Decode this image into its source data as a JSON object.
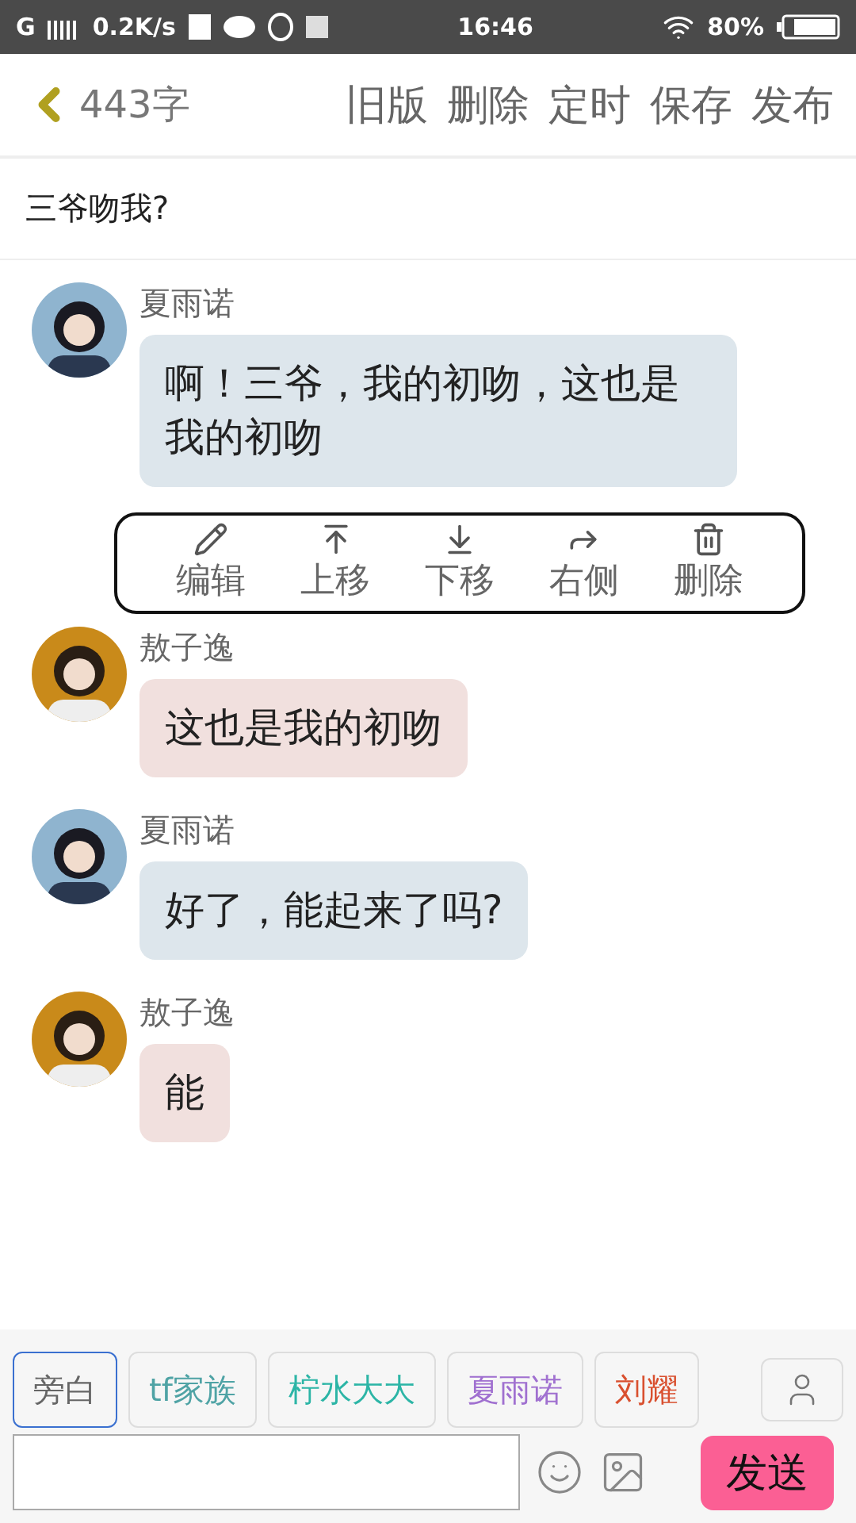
{
  "status_bar": {
    "network": "G",
    "speed": "0.2K/s",
    "time": "16:46",
    "battery": "80%"
  },
  "header": {
    "back": "443字",
    "actions": [
      "旧版",
      "删除",
      "定时",
      "保存",
      "发布"
    ]
  },
  "title": "三爷吻我?",
  "messages": [
    {
      "speaker": "夏雨诺",
      "text": "啊！三爷，我的初吻，这也是我的初吻",
      "color": "#dde6ec",
      "kind": "girl",
      "tools": [
        {
          "kind": "edit",
          "label": "编辑"
        },
        {
          "kind": "up",
          "label": "上移"
        },
        {
          "kind": "down",
          "label": "下移"
        },
        {
          "kind": "right",
          "label": "右侧"
        },
        {
          "kind": "delete",
          "label": "删除"
        }
      ]
    },
    {
      "speaker": "敖子逸",
      "text": "这也是我的初吻",
      "color": "#f1e0de",
      "kind": "boy"
    },
    {
      "speaker": "夏雨诺",
      "text": "好了，能起来了吗?",
      "color": "#dde6ec",
      "kind": "girl"
    },
    {
      "speaker": "敖子逸",
      "text": "能",
      "color": "#f1e0de",
      "kind": "boy"
    }
  ],
  "roles": [
    {
      "label": "旁白",
      "color": "#666666",
      "selected": true
    },
    {
      "label": "tf家族",
      "color": "#4fa3a5",
      "selected": false
    },
    {
      "label": "柠水大大",
      "color": "#2cb5a6",
      "selected": false
    },
    {
      "label": "夏雨诺",
      "color": "#a070d0",
      "selected": false
    },
    {
      "label": "刘耀",
      "color": "#d9502f",
      "selected": false
    }
  ],
  "composer": {
    "send": "发送"
  }
}
